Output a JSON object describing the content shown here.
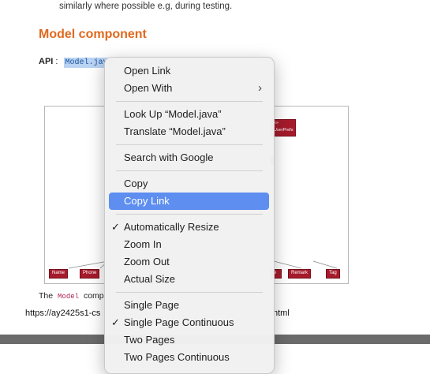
{
  "document": {
    "intro_text": "similarly where possible e.g, during testing.",
    "heading": "Model component",
    "api_label": "API",
    "api_sep": ":",
    "api_link": "Model.java",
    "desc_the": "The",
    "desc_code": "Model",
    "desc_rest": "comp",
    "url_text": "https://ay2425s1-cs",
    "url_tail": "html",
    "diagram": {
      "boxes": [
        "Name",
        "Phone",
        "Remark",
        "Tag",
        "«»\nUserPrefs",
        "e"
      ]
    }
  },
  "context_menu": {
    "items": [
      {
        "label": "Open Link",
        "checked": false,
        "submenu": false
      },
      {
        "label": "Open With",
        "checked": false,
        "submenu": true
      },
      {
        "label": "Look Up “Model.java”",
        "checked": false,
        "submenu": false
      },
      {
        "label": "Translate “Model.java”",
        "checked": false,
        "submenu": false
      },
      {
        "label": "Search with Google",
        "checked": false,
        "submenu": false
      },
      {
        "label": "Copy",
        "checked": false,
        "submenu": false
      },
      {
        "label": "Copy Link",
        "checked": false,
        "submenu": false,
        "highlighted": true
      },
      {
        "label": "Automatically Resize",
        "checked": true,
        "submenu": false
      },
      {
        "label": "Zoom In",
        "checked": false,
        "submenu": false
      },
      {
        "label": "Zoom Out",
        "checked": false,
        "submenu": false
      },
      {
        "label": "Actual Size",
        "checked": false,
        "submenu": false
      },
      {
        "label": "Single Page",
        "checked": false,
        "submenu": false
      },
      {
        "label": "Single Page Continuous",
        "checked": true,
        "submenu": false
      },
      {
        "label": "Two Pages",
        "checked": false,
        "submenu": false
      },
      {
        "label": "Two Pages Continuous",
        "checked": false,
        "submenu": false
      }
    ],
    "check_glyph": "✓",
    "submenu_glyph": "›",
    "highlight_color": "#5d8ef0"
  }
}
